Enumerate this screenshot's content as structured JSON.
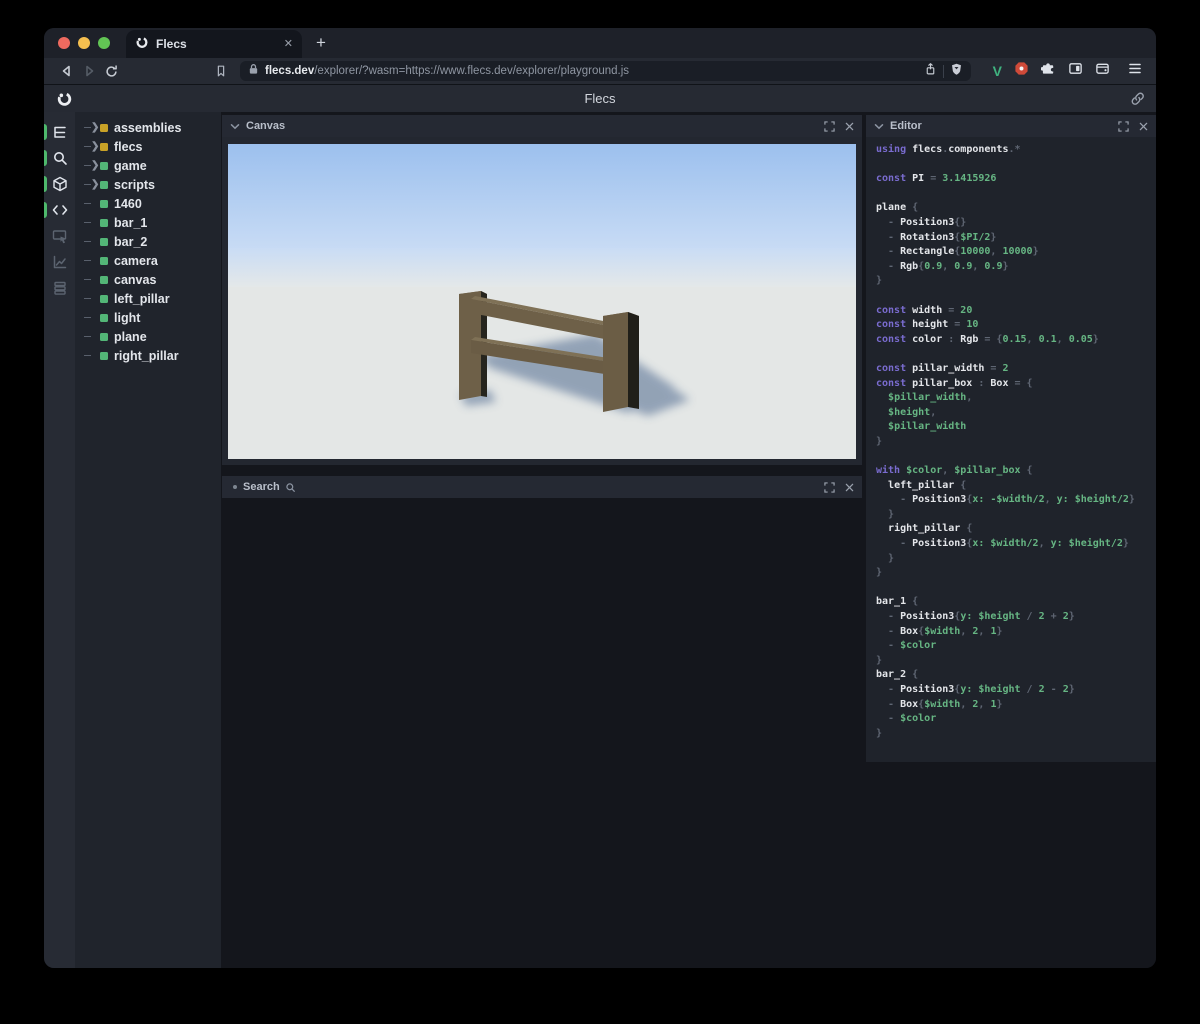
{
  "browser": {
    "tab_title": "Flecs",
    "close_tab_glyph": "✕",
    "new_tab_glyph": "+",
    "url_domain": "flecs.dev",
    "url_path": "/explorer/?wasm=https://www.flecs.dev/explorer/playground.js"
  },
  "header": {
    "title": "Flecs"
  },
  "sidebar": {
    "items": [
      {
        "name": "entity-tree",
        "active": true
      },
      {
        "name": "search",
        "active": true
      },
      {
        "name": "canvas-3d",
        "active": true
      },
      {
        "name": "script-editor",
        "active": true
      },
      {
        "name": "inspector",
        "active": false
      },
      {
        "name": "statistics",
        "active": false
      },
      {
        "name": "logs",
        "active": false
      }
    ]
  },
  "tree": {
    "items": [
      {
        "label": "assemblies",
        "kind": "module",
        "expandable": true
      },
      {
        "label": "flecs",
        "kind": "module",
        "expandable": true
      },
      {
        "label": "game",
        "kind": "entity",
        "expandable": true
      },
      {
        "label": "scripts",
        "kind": "entity",
        "expandable": true
      },
      {
        "label": "1460",
        "kind": "entity",
        "expandable": false
      },
      {
        "label": "bar_1",
        "kind": "entity",
        "expandable": false
      },
      {
        "label": "bar_2",
        "kind": "entity",
        "expandable": false
      },
      {
        "label": "camera",
        "kind": "entity",
        "expandable": false
      },
      {
        "label": "canvas",
        "kind": "entity",
        "expandable": false
      },
      {
        "label": "left_pillar",
        "kind": "entity",
        "expandable": false
      },
      {
        "label": "light",
        "kind": "entity",
        "expandable": false
      },
      {
        "label": "plane",
        "kind": "entity",
        "expandable": false
      },
      {
        "label": "right_pillar",
        "kind": "entity",
        "expandable": false
      }
    ]
  },
  "panels": {
    "canvas": {
      "title": "Canvas"
    },
    "search": {
      "title": "Search"
    },
    "editor": {
      "title": "Editor",
      "code": [
        [
          {
            "t": "using ",
            "c": "k"
          },
          {
            "t": "flecs",
            "c": "i"
          },
          {
            "t": ".",
            "c": "p"
          },
          {
            "t": "components",
            "c": "i"
          },
          {
            "t": ".*",
            "c": "p"
          }
        ],
        [],
        [
          {
            "t": "const ",
            "c": "k"
          },
          {
            "t": "PI",
            "c": "i"
          },
          {
            "t": " = ",
            "c": "p"
          },
          {
            "t": "3.1415926",
            "c": "v"
          }
        ],
        [],
        [
          {
            "t": "plane ",
            "c": "i"
          },
          {
            "t": "{",
            "c": "p"
          }
        ],
        [
          {
            "t": "  - ",
            "c": "p"
          },
          {
            "t": "Position3",
            "c": "i"
          },
          {
            "t": "{}",
            "c": "p"
          }
        ],
        [
          {
            "t": "  - ",
            "c": "p"
          },
          {
            "t": "Rotation3",
            "c": "i"
          },
          {
            "t": "{",
            "c": "p"
          },
          {
            "t": "$PI/2",
            "c": "v"
          },
          {
            "t": "}",
            "c": "p"
          }
        ],
        [
          {
            "t": "  - ",
            "c": "p"
          },
          {
            "t": "Rectangle",
            "c": "i"
          },
          {
            "t": "{",
            "c": "p"
          },
          {
            "t": "10000",
            "c": "v"
          },
          {
            "t": ", ",
            "c": "p"
          },
          {
            "t": "10000",
            "c": "v"
          },
          {
            "t": "}",
            "c": "p"
          }
        ],
        [
          {
            "t": "  - ",
            "c": "p"
          },
          {
            "t": "Rgb",
            "c": "i"
          },
          {
            "t": "{",
            "c": "p"
          },
          {
            "t": "0.9",
            "c": "v"
          },
          {
            "t": ", ",
            "c": "p"
          },
          {
            "t": "0.9",
            "c": "v"
          },
          {
            "t": ", ",
            "c": "p"
          },
          {
            "t": "0.9",
            "c": "v"
          },
          {
            "t": "}",
            "c": "p"
          }
        ],
        [
          {
            "t": "}",
            "c": "p"
          }
        ],
        [],
        [
          {
            "t": "const ",
            "c": "k"
          },
          {
            "t": "width",
            "c": "i"
          },
          {
            "t": " = ",
            "c": "p"
          },
          {
            "t": "20",
            "c": "v"
          }
        ],
        [
          {
            "t": "const ",
            "c": "k"
          },
          {
            "t": "height",
            "c": "i"
          },
          {
            "t": " = ",
            "c": "p"
          },
          {
            "t": "10",
            "c": "v"
          }
        ],
        [
          {
            "t": "const ",
            "c": "k"
          },
          {
            "t": "color",
            "c": "i"
          },
          {
            "t": " : ",
            "c": "p"
          },
          {
            "t": "Rgb",
            "c": "i"
          },
          {
            "t": " = {",
            "c": "p"
          },
          {
            "t": "0.15",
            "c": "v"
          },
          {
            "t": ", ",
            "c": "p"
          },
          {
            "t": "0.1",
            "c": "v"
          },
          {
            "t": ", ",
            "c": "p"
          },
          {
            "t": "0.05",
            "c": "v"
          },
          {
            "t": "}",
            "c": "p"
          }
        ],
        [],
        [
          {
            "t": "const ",
            "c": "k"
          },
          {
            "t": "pillar_width",
            "c": "i"
          },
          {
            "t": " = ",
            "c": "p"
          },
          {
            "t": "2",
            "c": "v"
          }
        ],
        [
          {
            "t": "const ",
            "c": "k"
          },
          {
            "t": "pillar_box",
            "c": "i"
          },
          {
            "t": " : ",
            "c": "p"
          },
          {
            "t": "Box",
            "c": "i"
          },
          {
            "t": " = {",
            "c": "p"
          }
        ],
        [
          {
            "t": "  ",
            "c": "p"
          },
          {
            "t": "$pillar_width",
            "c": "v"
          },
          {
            "t": ",",
            "c": "p"
          }
        ],
        [
          {
            "t": "  ",
            "c": "p"
          },
          {
            "t": "$height",
            "c": "v"
          },
          {
            "t": ",",
            "c": "p"
          }
        ],
        [
          {
            "t": "  ",
            "c": "p"
          },
          {
            "t": "$pillar_width",
            "c": "v"
          }
        ],
        [
          {
            "t": "}",
            "c": "p"
          }
        ],
        [],
        [
          {
            "t": "with ",
            "c": "k"
          },
          {
            "t": "$color",
            "c": "v"
          },
          {
            "t": ", ",
            "c": "p"
          },
          {
            "t": "$pillar_box",
            "c": "v"
          },
          {
            "t": " {",
            "c": "p"
          }
        ],
        [
          {
            "t": "  ",
            "c": "p"
          },
          {
            "t": "left_pillar ",
            "c": "i"
          },
          {
            "t": "{",
            "c": "p"
          }
        ],
        [
          {
            "t": "    - ",
            "c": "p"
          },
          {
            "t": "Position3",
            "c": "i"
          },
          {
            "t": "{",
            "c": "p"
          },
          {
            "t": "x: -$width/2",
            "c": "v"
          },
          {
            "t": ", ",
            "c": "p"
          },
          {
            "t": "y: $height/2",
            "c": "v"
          },
          {
            "t": "}",
            "c": "p"
          }
        ],
        [
          {
            "t": "  }",
            "c": "p"
          }
        ],
        [
          {
            "t": "  ",
            "c": "p"
          },
          {
            "t": "right_pillar ",
            "c": "i"
          },
          {
            "t": "{",
            "c": "p"
          }
        ],
        [
          {
            "t": "    - ",
            "c": "p"
          },
          {
            "t": "Position3",
            "c": "i"
          },
          {
            "t": "{",
            "c": "p"
          },
          {
            "t": "x: $width/2",
            "c": "v"
          },
          {
            "t": ", ",
            "c": "p"
          },
          {
            "t": "y: $height/2",
            "c": "v"
          },
          {
            "t": "}",
            "c": "p"
          }
        ],
        [
          {
            "t": "  }",
            "c": "p"
          }
        ],
        [
          {
            "t": "}",
            "c": "p"
          }
        ],
        [],
        [
          {
            "t": "bar_1 ",
            "c": "i"
          },
          {
            "t": "{",
            "c": "p"
          }
        ],
        [
          {
            "t": "  - ",
            "c": "p"
          },
          {
            "t": "Position3",
            "c": "i"
          },
          {
            "t": "{",
            "c": "p"
          },
          {
            "t": "y: $height",
            "c": "v"
          },
          {
            "t": " / ",
            "c": "p"
          },
          {
            "t": "2",
            "c": "v"
          },
          {
            "t": " + ",
            "c": "p"
          },
          {
            "t": "2",
            "c": "v"
          },
          {
            "t": "}",
            "c": "p"
          }
        ],
        [
          {
            "t": "  - ",
            "c": "p"
          },
          {
            "t": "Box",
            "c": "i"
          },
          {
            "t": "{",
            "c": "p"
          },
          {
            "t": "$width",
            "c": "v"
          },
          {
            "t": ", ",
            "c": "p"
          },
          {
            "t": "2",
            "c": "v"
          },
          {
            "t": ", ",
            "c": "p"
          },
          {
            "t": "1",
            "c": "v"
          },
          {
            "t": "}",
            "c": "p"
          }
        ],
        [
          {
            "t": "  - ",
            "c": "p"
          },
          {
            "t": "$color",
            "c": "v"
          }
        ],
        [
          {
            "t": "}",
            "c": "p"
          }
        ],
        [
          {
            "t": "bar_2 ",
            "c": "i"
          },
          {
            "t": "{",
            "c": "p"
          }
        ],
        [
          {
            "t": "  - ",
            "c": "p"
          },
          {
            "t": "Position3",
            "c": "i"
          },
          {
            "t": "{",
            "c": "p"
          },
          {
            "t": "y: $height",
            "c": "v"
          },
          {
            "t": " / ",
            "c": "p"
          },
          {
            "t": "2",
            "c": "v"
          },
          {
            "t": " - ",
            "c": "p"
          },
          {
            "t": "2",
            "c": "v"
          },
          {
            "t": "}",
            "c": "p"
          }
        ],
        [
          {
            "t": "  - ",
            "c": "p"
          },
          {
            "t": "Box",
            "c": "i"
          },
          {
            "t": "{",
            "c": "p"
          },
          {
            "t": "$width",
            "c": "v"
          },
          {
            "t": ", ",
            "c": "p"
          },
          {
            "t": "2",
            "c": "v"
          },
          {
            "t": ", ",
            "c": "p"
          },
          {
            "t": "1",
            "c": "v"
          },
          {
            "t": "}",
            "c": "p"
          }
        ],
        [
          {
            "t": "  - ",
            "c": "p"
          },
          {
            "t": "$color",
            "c": "v"
          }
        ],
        [
          {
            "t": "}",
            "c": "p"
          }
        ]
      ]
    }
  },
  "colors": {
    "accent_green": "#4eb96c",
    "module_yellow": "#c9a227",
    "entity_green": "#53b677",
    "keyword_purple": "#7a6cd0",
    "value_green": "#66b583",
    "sky_top": "#9cc0ee",
    "ground": "#e4e7e6",
    "wood_light": "#6e6048",
    "wood_dark": "#26251e"
  }
}
